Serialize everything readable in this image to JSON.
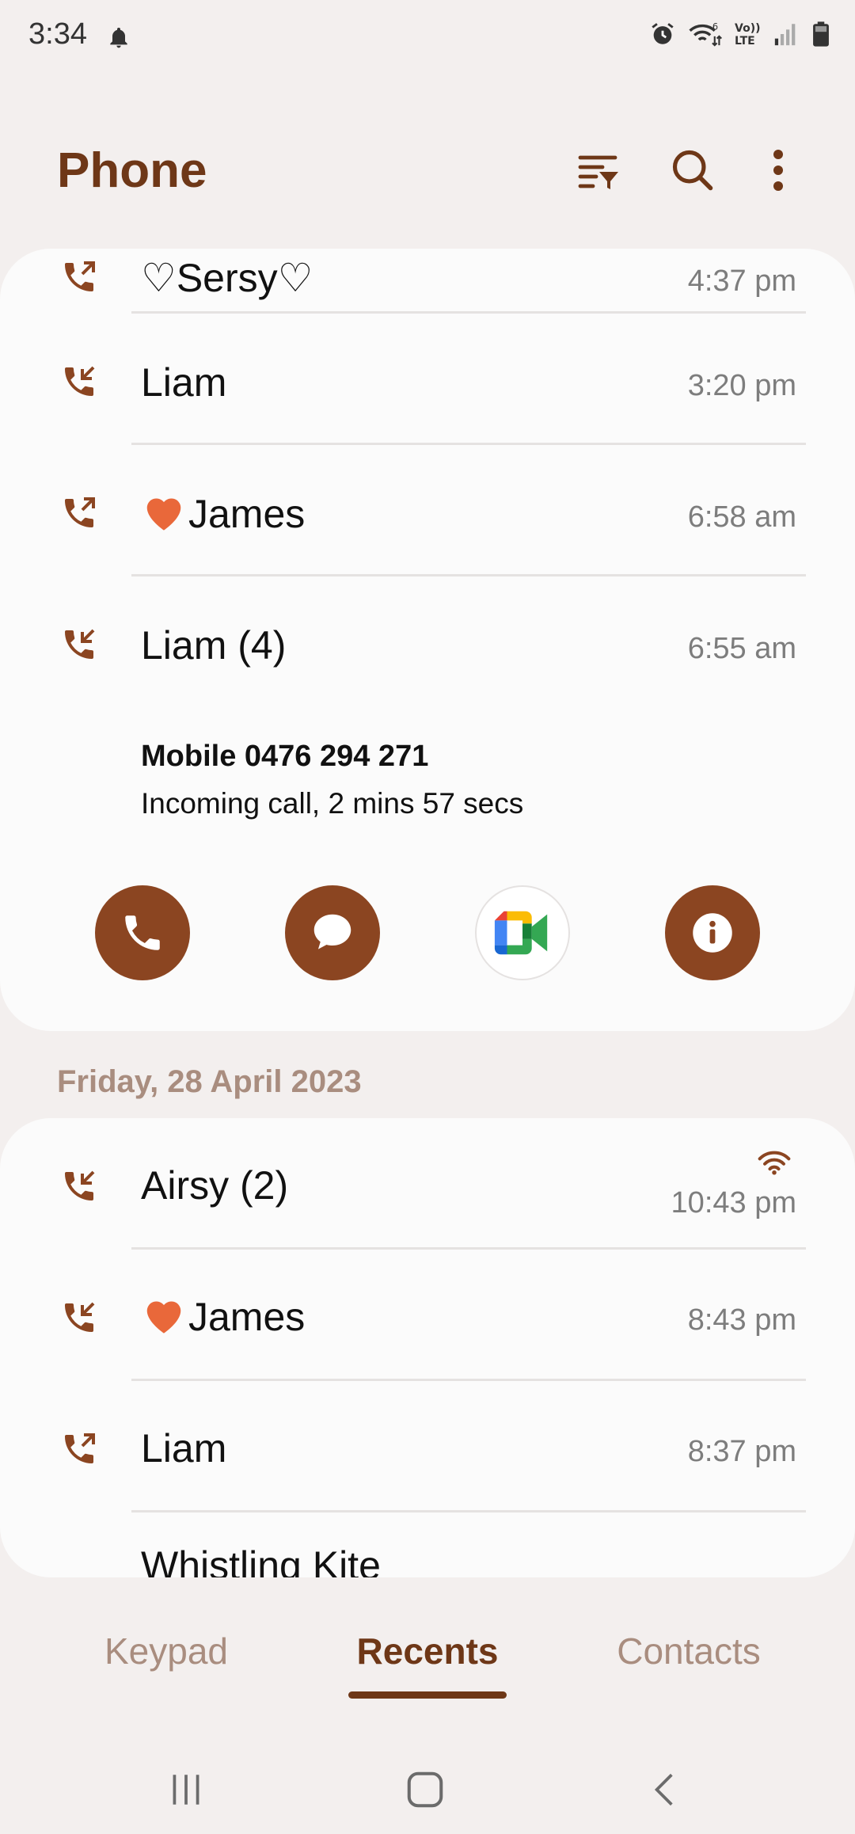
{
  "status_bar": {
    "time": "3:34",
    "icons": [
      "bell-icon",
      "alarm-icon",
      "wifi-calling-icon",
      "volte-icon",
      "signal-icon",
      "battery-icon"
    ],
    "volte_line1": "Vo))",
    "volte_line2": "LTE"
  },
  "header": {
    "title": "Phone",
    "actions": [
      "filter-icon",
      "search-icon",
      "more-options-icon"
    ]
  },
  "colors": {
    "accent": "#8b4521",
    "title": "#6e3717",
    "date_header": "#a98d7f",
    "background": "#f3efee",
    "card": "#fbfbfb"
  },
  "recents_today": [
    {
      "name": "♡Sersy♡",
      "time": "4:37 pm",
      "direction": "outgoing"
    },
    {
      "name": "Liam",
      "time": "3:20 pm",
      "direction": "incoming"
    },
    {
      "name": "James",
      "time": "6:58 am",
      "direction": "outgoing",
      "heart": true
    },
    {
      "name": "Liam (4)",
      "time": "6:55 am",
      "direction": "incoming",
      "expanded": true
    }
  ],
  "expanded_detail": {
    "number": "Mobile 0476 294 271",
    "description": "Incoming call, 2 mins 57 secs",
    "actions": [
      "call-icon",
      "message-icon",
      "google-meet-icon",
      "info-icon"
    ]
  },
  "date_header": "Friday, 28 April 2023",
  "recents_friday": [
    {
      "name": "Airsy (2)",
      "time": "10:43 pm",
      "direction": "incoming",
      "wifi_call": true
    },
    {
      "name": "James",
      "time": "8:43 pm",
      "direction": "incoming",
      "heart": true
    },
    {
      "name": "Liam",
      "time": "8:37 pm",
      "direction": "outgoing"
    },
    {
      "name": "Whistling Kite",
      "time": "",
      "direction": "outgoing",
      "partial": true
    }
  ],
  "tabs": [
    {
      "label": "Keypad",
      "active": false
    },
    {
      "label": "Recents",
      "active": true
    },
    {
      "label": "Contacts",
      "active": false
    }
  ],
  "nav_bar": [
    "recent-apps-icon",
    "home-icon",
    "back-icon"
  ]
}
